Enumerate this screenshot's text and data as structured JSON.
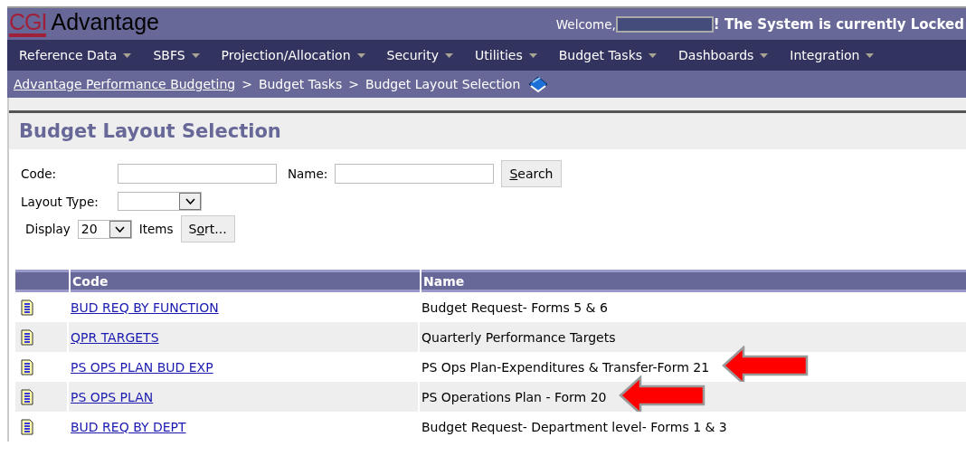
{
  "header": {
    "logo_mark": "CGI",
    "logo_text": "Advantage",
    "welcome": "Welcome,",
    "user_redacted": true,
    "notice": "! The System is currently Locked"
  },
  "menu": [
    {
      "label": "Reference Data"
    },
    {
      "label": "SBFS"
    },
    {
      "label": "Projection/Allocation"
    },
    {
      "label": "Security"
    },
    {
      "label": "Utilities"
    },
    {
      "label": "Budget Tasks"
    },
    {
      "label": "Dashboards"
    },
    {
      "label": "Integration"
    }
  ],
  "breadcrumb": [
    {
      "label": "Advantage Performance Budgeting",
      "link": true
    },
    {
      "label": "Budget Tasks",
      "link": false
    },
    {
      "label": "Budget Layout Selection",
      "link": false
    }
  ],
  "breadcrumb_separator": ">",
  "page_title": "Budget Layout Selection",
  "filters": {
    "code_label": "Code:",
    "name_label": "Name:",
    "search_button": {
      "key": "S",
      "rest": "earch"
    },
    "layout_type_label": "Layout Type:",
    "display_label": "Display",
    "display_value": "20",
    "items_label": "Items",
    "sort_button": {
      "lead": "S",
      "key": "o",
      "rest": "rt..."
    }
  },
  "table": {
    "columns": [
      "Code",
      "Name"
    ],
    "rows": [
      {
        "code": "BUD REQ BY FUNCTION",
        "name": "Budget Request- Forms 5 & 6",
        "arrow": false
      },
      {
        "code": "QPR TARGETS",
        "name": "Quarterly Performance Targets",
        "arrow": false
      },
      {
        "code": "PS OPS PLAN BUD EXP",
        "name": "PS Ops Plan-Expenditures & Transfer-Form 21",
        "arrow": true
      },
      {
        "code": "PS OPS PLAN",
        "name": "PS Operations Plan - Form 20",
        "arrow": true
      },
      {
        "code": "BUD REQ BY DEPT",
        "name": "Budget Request- Department level- Forms 1 & 3",
        "arrow": false
      }
    ]
  }
}
